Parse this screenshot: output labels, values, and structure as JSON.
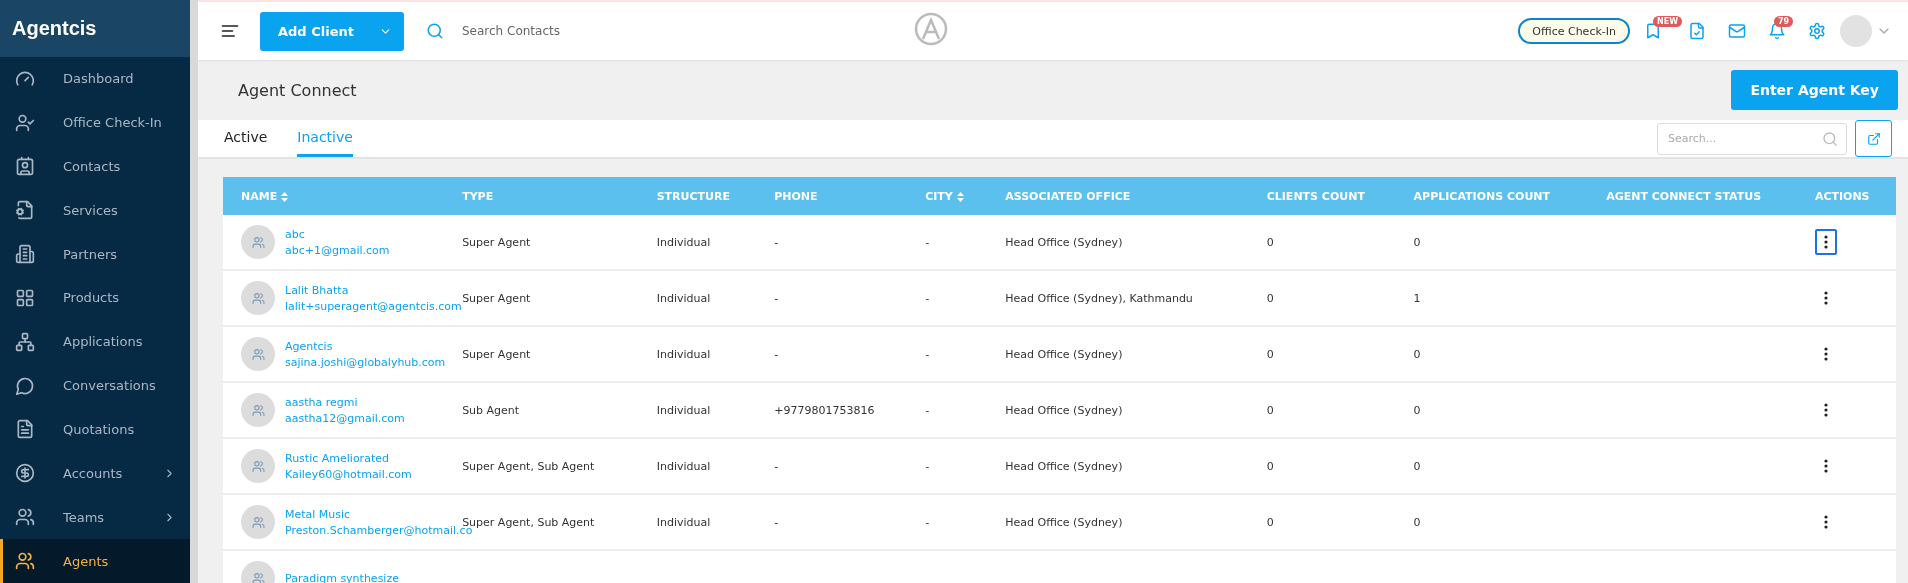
{
  "sidebar": {
    "brand": "Agentcis",
    "items": [
      {
        "label": "Dashboard",
        "selected": false,
        "expandable": false
      },
      {
        "label": "Office Check-In",
        "selected": false,
        "expandable": false
      },
      {
        "label": "Contacts",
        "selected": false,
        "expandable": false
      },
      {
        "label": "Services",
        "selected": false,
        "expandable": false
      },
      {
        "label": "Partners",
        "selected": false,
        "expandable": false
      },
      {
        "label": "Products",
        "selected": false,
        "expandable": false
      },
      {
        "label": "Applications",
        "selected": false,
        "expandable": false
      },
      {
        "label": "Conversations",
        "selected": false,
        "expandable": false
      },
      {
        "label": "Quotations",
        "selected": false,
        "expandable": false
      },
      {
        "label": "Accounts",
        "selected": false,
        "expandable": true
      },
      {
        "label": "Teams",
        "selected": false,
        "expandable": true
      },
      {
        "label": "Agents",
        "selected": true,
        "expandable": false
      }
    ]
  },
  "header": {
    "add_button": "Add Client",
    "search": {
      "placeholder": "Search Contacts"
    },
    "checkin_button": "Office Check-In",
    "new_badge": "NEW",
    "notification_count": "79"
  },
  "page": {
    "title": "Agent Connect",
    "action_button": "Enter Agent Key"
  },
  "tabs": [
    {
      "label": "Active",
      "selected": false
    },
    {
      "label": "Inactive",
      "selected": true
    }
  ],
  "table_search": {
    "placeholder": "Search..."
  },
  "table": {
    "columns": [
      {
        "label": "NAME",
        "sortable": true
      },
      {
        "label": "TYPE",
        "sortable": false
      },
      {
        "label": "STRUCTURE",
        "sortable": false
      },
      {
        "label": "PHONE",
        "sortable": false
      },
      {
        "label": "CITY",
        "sortable": true
      },
      {
        "label": "ASSOCIATED OFFICE",
        "sortable": false
      },
      {
        "label": "CLIENTS COUNT",
        "sortable": false
      },
      {
        "label": "APPLICATIONS COUNT",
        "sortable": false
      },
      {
        "label": "AGENT CONNECT STATUS",
        "sortable": false
      },
      {
        "label": "ACTIONS",
        "sortable": false
      }
    ],
    "rows": [
      {
        "name": "abc",
        "email": "abc+1@gmail.com",
        "type": "Super Agent",
        "structure": "Individual",
        "phone": "-",
        "city": "-",
        "office": "Head Office (Sydney)",
        "clients": "0",
        "applications": "0",
        "focused": true
      },
      {
        "name": "Lalit Bhatta",
        "email": "lalit+superagent@agentcis.com",
        "type": "Super Agent",
        "structure": "Individual",
        "phone": "-",
        "city": "-",
        "office": "Head Office (Sydney), Kathmandu",
        "clients": "0",
        "applications": "1",
        "focused": false
      },
      {
        "name": "Agentcis",
        "email": "sajina.joshi@globalyhub.com",
        "type": "Super Agent",
        "structure": "Individual",
        "phone": "-",
        "city": "-",
        "office": "Head Office (Sydney)",
        "clients": "0",
        "applications": "0",
        "focused": false
      },
      {
        "name": "aastha regmi",
        "email": "aastha12@gmail.com",
        "type": "Sub Agent",
        "structure": "Individual",
        "phone": "+9779801753816",
        "city": "-",
        "office": "Head Office (Sydney)",
        "clients": "0",
        "applications": "0",
        "focused": false
      },
      {
        "name": "Rustic Ameliorated",
        "email": "Kailey60@hotmail.com",
        "type": "Super Agent, Sub Agent",
        "structure": "Individual",
        "phone": "-",
        "city": "-",
        "office": "Head Office (Sydney)",
        "clients": "0",
        "applications": "0",
        "focused": false
      },
      {
        "name": "Metal Music",
        "email": "Preston.Schamberger@hotmail.co",
        "type": "Super Agent, Sub Agent",
        "structure": "Individual",
        "phone": "-",
        "city": "-",
        "office": "Head Office (Sydney)",
        "clients": "0",
        "applications": "0",
        "focused": false
      },
      {
        "name": "Paradigm synthesize"
      }
    ]
  }
}
